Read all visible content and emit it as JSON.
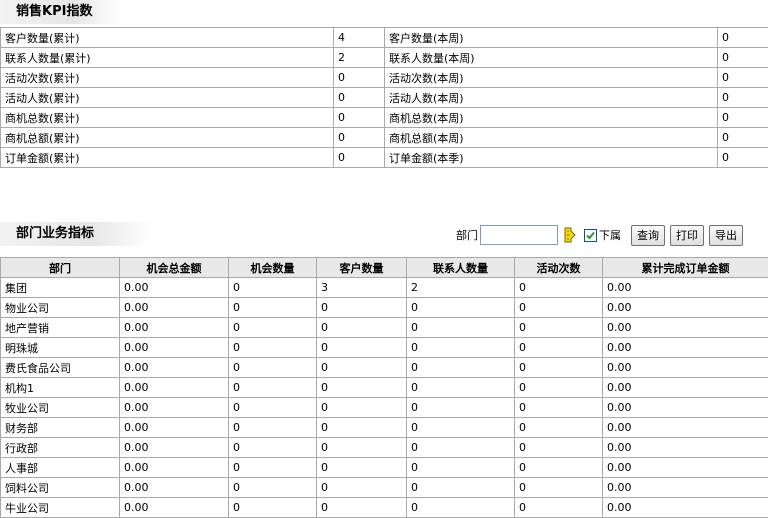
{
  "kpi": {
    "title": "销售KPI指数",
    "rows": [
      {
        "label_a": "客户数量(累计)",
        "value_a": "4",
        "label_b": "客户数量(本周)",
        "value_b": "0"
      },
      {
        "label_a": "联系人数量(累计)",
        "value_a": "2",
        "label_b": "联系人数量(本周)",
        "value_b": "0"
      },
      {
        "label_a": "活动次数(累计)",
        "value_a": "0",
        "label_b": "活动次数(本周)",
        "value_b": "0"
      },
      {
        "label_a": "活动人数(累计)",
        "value_a": "0",
        "label_b": "活动人数(本周)",
        "value_b": "0"
      },
      {
        "label_a": "商机总数(累计)",
        "value_a": "0",
        "label_b": "商机总数(本周)",
        "value_b": "0"
      },
      {
        "label_a": "商机总额(累计)",
        "value_a": "0",
        "label_b": "商机总额(本周)",
        "value_b": "0"
      },
      {
        "label_a": "订单金额(累计)",
        "value_a": "0",
        "label_b": "订单金额(本季)",
        "value_b": "0"
      }
    ]
  },
  "dept": {
    "title": "部门业务指标",
    "filter": {
      "label": "部门",
      "value": "",
      "include_sub_label": "下属",
      "include_sub_checked": true
    },
    "buttons": {
      "query": "查询",
      "print": "打印",
      "export": "导出"
    },
    "columns": [
      "部门",
      "机会总金额",
      "机会数量",
      "客户数量",
      "联系人数量",
      "活动次数",
      "累计完成订单金额"
    ],
    "rows": [
      [
        "集团",
        "0.00",
        "0",
        "3",
        "2",
        "0",
        "0.00"
      ],
      [
        "物业公司",
        "0.00",
        "0",
        "0",
        "0",
        "0",
        "0.00"
      ],
      [
        "地产营销",
        "0.00",
        "0",
        "0",
        "0",
        "0",
        "0.00"
      ],
      [
        "明珠城",
        "0.00",
        "0",
        "0",
        "0",
        "0",
        "0.00"
      ],
      [
        "费氏食品公司",
        "0.00",
        "0",
        "0",
        "0",
        "0",
        "0.00"
      ],
      [
        "机构1",
        "0.00",
        "0",
        "0",
        "0",
        "0",
        "0.00"
      ],
      [
        "牧业公司",
        "0.00",
        "0",
        "0",
        "0",
        "0",
        "0.00"
      ],
      [
        "财务部",
        "0.00",
        "0",
        "0",
        "0",
        "0",
        "0.00"
      ],
      [
        "行政部",
        "0.00",
        "0",
        "0",
        "0",
        "0",
        "0.00"
      ],
      [
        "人事部",
        "0.00",
        "0",
        "0",
        "0",
        "0",
        "0.00"
      ],
      [
        "饲料公司",
        "0.00",
        "0",
        "0",
        "0",
        "0",
        "0.00"
      ],
      [
        "牛业公司",
        "0.00",
        "0",
        "0",
        "0",
        "0",
        "0.00"
      ]
    ]
  }
}
